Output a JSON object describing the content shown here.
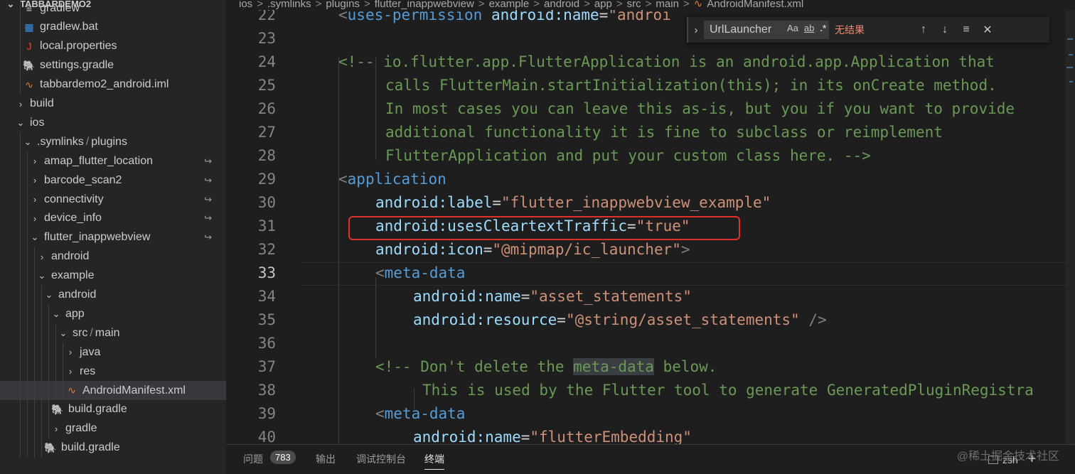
{
  "sidebar": {
    "project_title": "TABBARDEMO2",
    "items": [
      {
        "label": "gradlew",
        "icon": "lines-file-icon"
      },
      {
        "label": "gradlew.bat",
        "icon": "windows-file-icon"
      },
      {
        "label": "local.properties",
        "icon": "java-file-icon"
      },
      {
        "label": "settings.gradle",
        "icon": "gradle-elephant-icon"
      },
      {
        "label": "tabbardemo2_android.iml",
        "icon": "rss-file-icon"
      },
      {
        "label": "build",
        "icon": "chevron-right-icon"
      },
      {
        "label": "ios",
        "icon": "chevron-down-icon"
      },
      {
        "label_a": ".symlinks",
        "label_b": "plugins",
        "icon": "chevron-down-icon"
      },
      {
        "label": "amap_flutter_location",
        "icon": "chevron-right-icon"
      },
      {
        "label": "barcode_scan2",
        "icon": "chevron-right-icon"
      },
      {
        "label": "connectivity",
        "icon": "chevron-right-icon"
      },
      {
        "label": "device_info",
        "icon": "chevron-right-icon"
      },
      {
        "label": "flutter_inappwebview",
        "icon": "chevron-down-icon"
      },
      {
        "label": "android",
        "icon": "chevron-right-icon"
      },
      {
        "label": "example",
        "icon": "chevron-down-icon"
      },
      {
        "label": "android",
        "icon": "chevron-down-icon"
      },
      {
        "label": "app",
        "icon": "chevron-down-icon"
      },
      {
        "label_a": "src",
        "label_b": "main",
        "icon": "chevron-down-icon"
      },
      {
        "label": "java",
        "icon": "chevron-right-icon"
      },
      {
        "label": "res",
        "icon": "chevron-right-icon"
      },
      {
        "label": "AndroidManifest.xml",
        "icon": "rss-file-icon"
      },
      {
        "label": "build.gradle",
        "icon": "gradle-elephant-icon"
      },
      {
        "label": "gradle",
        "icon": "chevron-right-icon"
      },
      {
        "label": "build.gradle",
        "icon": "gradle-elephant-icon"
      }
    ],
    "slash": "/",
    "symlink_glyph": "↪"
  },
  "breadcrumb": {
    "parts": [
      "ios",
      ".symlinks",
      "plugins",
      "flutter_inappwebview",
      "example",
      "android",
      "app",
      "src",
      "main",
      "AndroidManifest.xml"
    ],
    "separator": ">"
  },
  "editor": {
    "line_numbers": [
      "22",
      "23",
      "24",
      "25",
      "26",
      "27",
      "28",
      "29",
      "30",
      "31",
      "32",
      "33",
      "34",
      "35",
      "36",
      "37",
      "38",
      "39",
      "40"
    ],
    "active_line": "33",
    "lines": {
      "l22": {
        "lt": "<",
        "tag": "uses-permission",
        "attr": "android:name",
        "eq": "=",
        "str": "\"androi"
      },
      "l24": "<!-- io.flutter.app.FlutterApplication is an android.app.Application that",
      "l25": "calls FlutterMain.startInitialization(this); in its onCreate method.",
      "l26": "In most cases you can leave this as-is, but you if you want to provide",
      "l27": "additional functionality it is fine to subclass or reimplement",
      "l28": "FlutterApplication and put your custom class here. -->",
      "l29": {
        "lt": "<",
        "tag": "application"
      },
      "l30": {
        "attr": "android:label",
        "eq": "=",
        "str": "\"flutter_inappwebview_example\""
      },
      "l31": {
        "attr": "android:usesCleartextTraffic",
        "eq": "=",
        "str": "\"true\""
      },
      "l32": {
        "attr": "android:icon",
        "eq": "=",
        "str": "\"@mipmap/ic_launcher\"",
        "gt": ">"
      },
      "l33": {
        "lt": "<",
        "tag": "meta-data"
      },
      "l34": {
        "attr": "android:name",
        "eq": "=",
        "str": "\"asset_statements\""
      },
      "l35": {
        "attr": "android:resource",
        "eq": "=",
        "str": "\"@string/asset_statements\"",
        "close": " />"
      },
      "l37": {
        "a": "<!-- Don't delete the ",
        "hl": "meta-data",
        "b": " below."
      },
      "l38": "This is used by the Flutter tool to generate GeneratedPluginRegistra",
      "l39": {
        "lt": "<",
        "tag": "meta-data"
      },
      "l40": {
        "attr": "android:name",
        "eq": "=",
        "str": "\"flutterEmbedding\""
      }
    }
  },
  "find_widget": {
    "query": "UrlLauncher",
    "match_case": "Aa",
    "whole_word": "ab",
    "regex": ".*",
    "result": "无结果",
    "toggle_icon": "›",
    "prev": "↑",
    "next": "↓",
    "selection": "≡",
    "close": "✕"
  },
  "panel": {
    "tabs": [
      "问题",
      "输出",
      "调试控制台",
      "终端"
    ],
    "active_tab": "终端",
    "problems_count": "783",
    "terminal_shell": "zsh",
    "add": "+",
    "watermark": "@稀土掘金技术社区"
  },
  "colors": {
    "highlight_box": "#e0302a",
    "comment": "#6a9955",
    "attribute": "#9cdcfe",
    "string": "#ce9178",
    "tag": "#569cd6"
  }
}
